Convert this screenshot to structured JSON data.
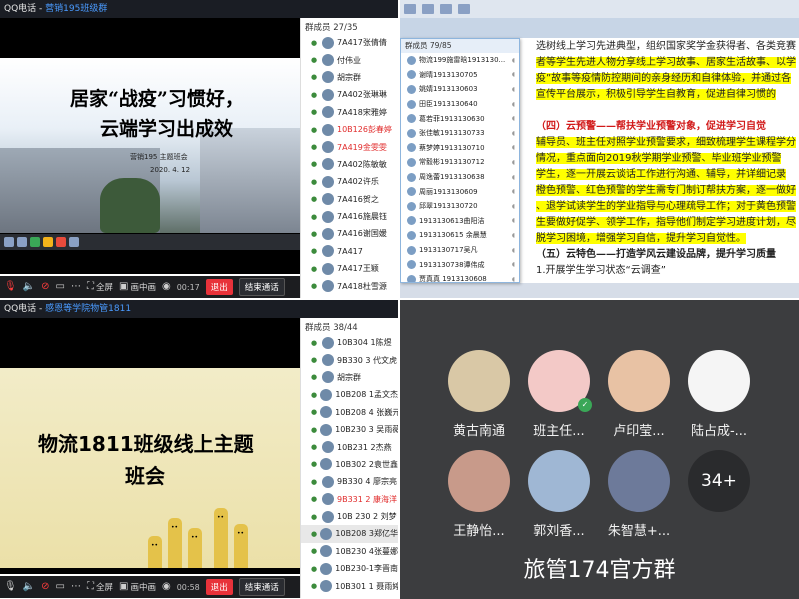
{
  "top_left": {
    "window_title_prefix": "QQ电话 - ",
    "window_title_group": "营销195班级群",
    "slide": {
      "title_line1": "居家“战疫”习惯好，",
      "title_line2": "云端学习出成效",
      "author": "营销195    主题班会",
      "date": "2020. 4. 12"
    },
    "member_header": "群成员 27/35",
    "members": [
      {
        "name": "7A417张倩倩",
        "state": "normal"
      },
      {
        "name": "付伟业",
        "state": "normal"
      },
      {
        "name": "胡宗群",
        "state": "normal"
      },
      {
        "name": "7A402张琳琳",
        "state": "normal"
      },
      {
        "name": "7A418宋雅婷",
        "state": "normal"
      },
      {
        "name": "10B126彭春婷",
        "state": "speaking"
      },
      {
        "name": "7A419金雯雯",
        "state": "speaking"
      },
      {
        "name": "7A402陈敏敏",
        "state": "normal"
      },
      {
        "name": "7A402许乐",
        "state": "normal"
      },
      {
        "name": "7A416贺之",
        "state": "normal"
      },
      {
        "name": "7A416施晨钰",
        "state": "normal"
      },
      {
        "name": "7A416谢国媛",
        "state": "normal"
      },
      {
        "name": "7A417",
        "state": "normal"
      },
      {
        "name": "7A417王颖",
        "state": "normal"
      },
      {
        "name": "7A418杜雪源",
        "state": "normal"
      },
      {
        "name": "7A418严璐璐",
        "state": "normal"
      }
    ],
    "toolbar": {
      "fullscreen": "全屏",
      "pip": "画中画",
      "time": "00:17",
      "exit": "退出",
      "end": "结束通话"
    }
  },
  "bottom_left": {
    "window_title_prefix": "QQ电话 - ",
    "window_title_group": "感恩等学院物管1811",
    "slide": {
      "title_line1": "物流1811班级线上主题",
      "title_line2": "班会"
    },
    "member_header": "群成员 38/44",
    "members": [
      {
        "name": "10B304 1陈煜",
        "state": "normal"
      },
      {
        "name": "9B330 3   代文虎",
        "state": "normal"
      },
      {
        "name": "胡宗群",
        "state": "normal"
      },
      {
        "name": "10B208   1孟文杰",
        "state": "normal"
      },
      {
        "name": "10B208 4 张巍元",
        "state": "normal"
      },
      {
        "name": "10B230 3 吴雨薇",
        "state": "normal"
      },
      {
        "name": "10B231   2杰燕",
        "state": "normal"
      },
      {
        "name": "10B302 2袁世鑫",
        "state": "normal"
      },
      {
        "name": "9B330 4 廖宗亮",
        "state": "normal"
      },
      {
        "name": "9B331 2  康海洋",
        "state": "speaking"
      },
      {
        "name": "10B 230 2  刘梦",
        "state": "normal"
      },
      {
        "name": "10B208 3郑亿华",
        "state": "active"
      },
      {
        "name": "10B230 4张蔓娜",
        "state": "normal"
      },
      {
        "name": "10B230-1李晋南",
        "state": "normal"
      },
      {
        "name": "10B301 1 聂雨婷",
        "state": "normal"
      },
      {
        "name": "10B301 4李文清",
        "state": "normal"
      }
    ],
    "toolbar": {
      "fullscreen": "全屏",
      "pip": "画中画",
      "time": "00:58",
      "exit": "退出",
      "end": "结束通话"
    }
  },
  "top_right": {
    "popup_header": "群成员 79/85",
    "popup_members": [
      "物流199施雷晗1913130...",
      "谢晴1913130705",
      "姚婧1913130603",
      "田臣1913130640",
      "葛若菲1913130630",
      "张佳敏1913130733",
      "蔡梦婷1913130710",
      "常毅彬1913130712",
      "周逸蕾1913130638",
      "周丽1913130609",
      "邱翠1913130720",
      "1913130613曲阳洁",
      "1913130615 余晨慧",
      "1913130717吴凡",
      "1913130738谭伟成",
      "贾真真 1913130608"
    ],
    "doc_lines": [
      {
        "text": "选树线上学习先进典型，组织国家奖学金获得者、各类竞赛",
        "style": "normal",
        "hl": ""
      },
      {
        "text": "者等学生先进人物分享线上学习故事、居家生活故事、以学",
        "style": "normal",
        "hl": "以学"
      },
      {
        "text": "疫”故事等疫情防控期间的亲身经历和自律体验，并通过各",
        "style": "normal",
        "hl": "疫”故事等疫情防控期间的亲身经历和自律体验，并通过各"
      },
      {
        "text": "宣传平台展示，积极引导学生自教育，促进自律习惯的",
        "style": "normal",
        "hl": "宣传平台展示，"
      },
      {
        "text": "",
        "style": "normal",
        "hl": ""
      },
      {
        "text": "（四）云预警——帮扶学业预警对象，促进学习自觉",
        "style": "red",
        "hl": ""
      },
      {
        "text": "辅导员、班主任对照学业预警要求，细致梳理学生课程学分",
        "style": "normal",
        "hl": "辅导员、班主任对照学业预警要求，细致梳理学生课程学分"
      },
      {
        "text": "情况，重点面向2019秋学期学业预警、毕业班学业预警",
        "style": "normal",
        "hl": "情况，重点面向2019秋学期学业预警、毕业班学业预警"
      },
      {
        "text": "学生，逐一开展云谈话工作进行沟通、辅导，并详细记录",
        "style": "normal",
        "hl": "学生，逐一开展云谈话工作进行沟通、辅导，并详细记录"
      },
      {
        "text": "橙色预警、红色预警的学生需专门制订帮扶方案，逐一做好",
        "style": "normal",
        "hl": "橙色预警、红色预警的学生需专门制订帮扶方案，逐一做好"
      },
      {
        "text": "、退学试读学生的学业指导与心理疏导工作；对于黄色预警",
        "style": "normal",
        "hl": "、退学试读学生的学业指导与心理疏导工作；对于黄色预警"
      },
      {
        "text": "生要做好促学、领学工作，指导他们制定学习进度计划，尽",
        "style": "normal",
        "hl": "生要做好促学、领学工作，指导他们制定学习进度计划，尽"
      },
      {
        "text": "脱学习困境，增强学习自信，提升学习自觉性。",
        "style": "normal",
        "hl": "脱学习困境，增强学习自信，提升学习自觉性。"
      },
      {
        "text": "（五）云特色——打造学风云建设品牌，提升学习质量",
        "style": "heading",
        "hl": ""
      },
      {
        "text": "1.开展学生学习状态“云调查”",
        "style": "normal",
        "hl": ""
      }
    ]
  },
  "bottom_right": {
    "participants": [
      {
        "name": "黄古南通",
        "color": "#d9c8a6"
      },
      {
        "name": "班主任...",
        "color": "#f3c9c7"
      },
      {
        "name": "卢印莹...",
        "color": "#e8c2a4"
      },
      {
        "name": "陆占成-...",
        "color": "#f5f5f5"
      },
      {
        "name": "王静怡...",
        "color": "#c89a8a"
      },
      {
        "name": "郭刘香...",
        "color": "#9fb7d4"
      },
      {
        "name": "朱智慧+...",
        "color": "#6d7a9a"
      }
    ],
    "more_count": "34+",
    "group_name": "旅管174官方群"
  }
}
